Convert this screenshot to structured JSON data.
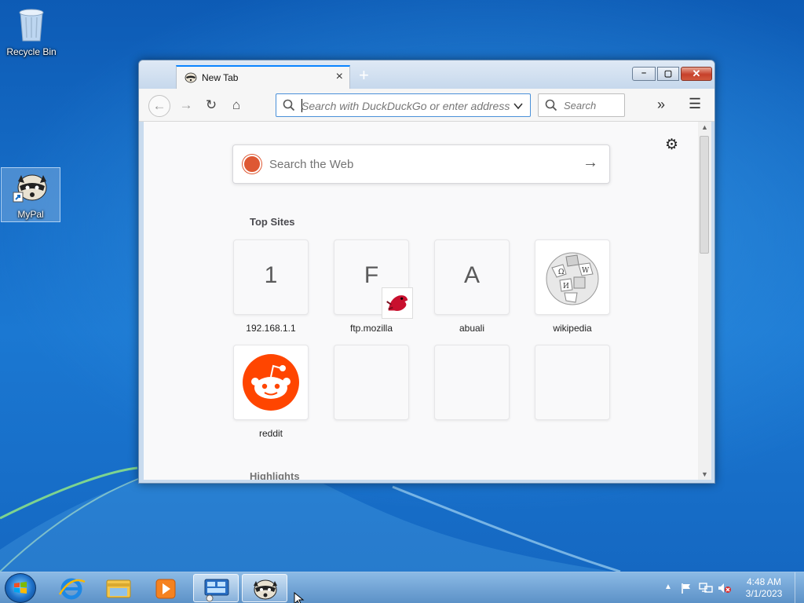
{
  "desktop": {
    "icons": [
      {
        "label": "Recycle Bin"
      },
      {
        "label": "MyPal"
      }
    ]
  },
  "window": {
    "tab": {
      "title": "New Tab",
      "close": "×"
    },
    "new_tab_symbol": "+",
    "controls": {
      "minimize": "–",
      "maximize": "▢",
      "close": "✕"
    }
  },
  "navbar": {
    "back": "←",
    "forward": "→",
    "reload": "↻",
    "home": "⌂",
    "url_placeholder": "Search with DuckDuckGo or enter address",
    "search_placeholder": "Search",
    "overflow": "»",
    "menu": "☰"
  },
  "newtab": {
    "web_search_placeholder": "Search the Web",
    "web_search_arrow": "→",
    "settings": "⚙",
    "top_sites_title": "Top Sites",
    "highlights_title": "Highlights",
    "top_sites": [
      {
        "letter": "1",
        "label": "192.168.1.1",
        "icon": "letter-tile"
      },
      {
        "letter": "F",
        "label": "ftp.mozilla",
        "icon": "red-dino-badge"
      },
      {
        "letter": "A",
        "label": "abuali",
        "icon": "letter-tile"
      },
      {
        "letter": "",
        "label": "wikipedia",
        "icon": "wikipedia-globe-icon"
      },
      {
        "letter": "",
        "label": "reddit",
        "icon": "reddit-icon"
      },
      {
        "letter": "",
        "label": "",
        "icon": "empty"
      },
      {
        "letter": "",
        "label": "",
        "icon": "empty"
      },
      {
        "letter": "",
        "label": "",
        "icon": "empty"
      }
    ]
  },
  "taskbar": {
    "clock_time": "4:48 AM",
    "clock_date": "3/1/2023",
    "pinned": [
      "internet-explorer-icon",
      "file-explorer-icon",
      "media-player-icon",
      "remote-desktop-icon",
      "mypal-icon"
    ]
  },
  "colors": {
    "accent": "#0a84ff",
    "duckduckgo": "#de5833",
    "reddit": "#ff4500",
    "close_button": "#c7402a"
  }
}
